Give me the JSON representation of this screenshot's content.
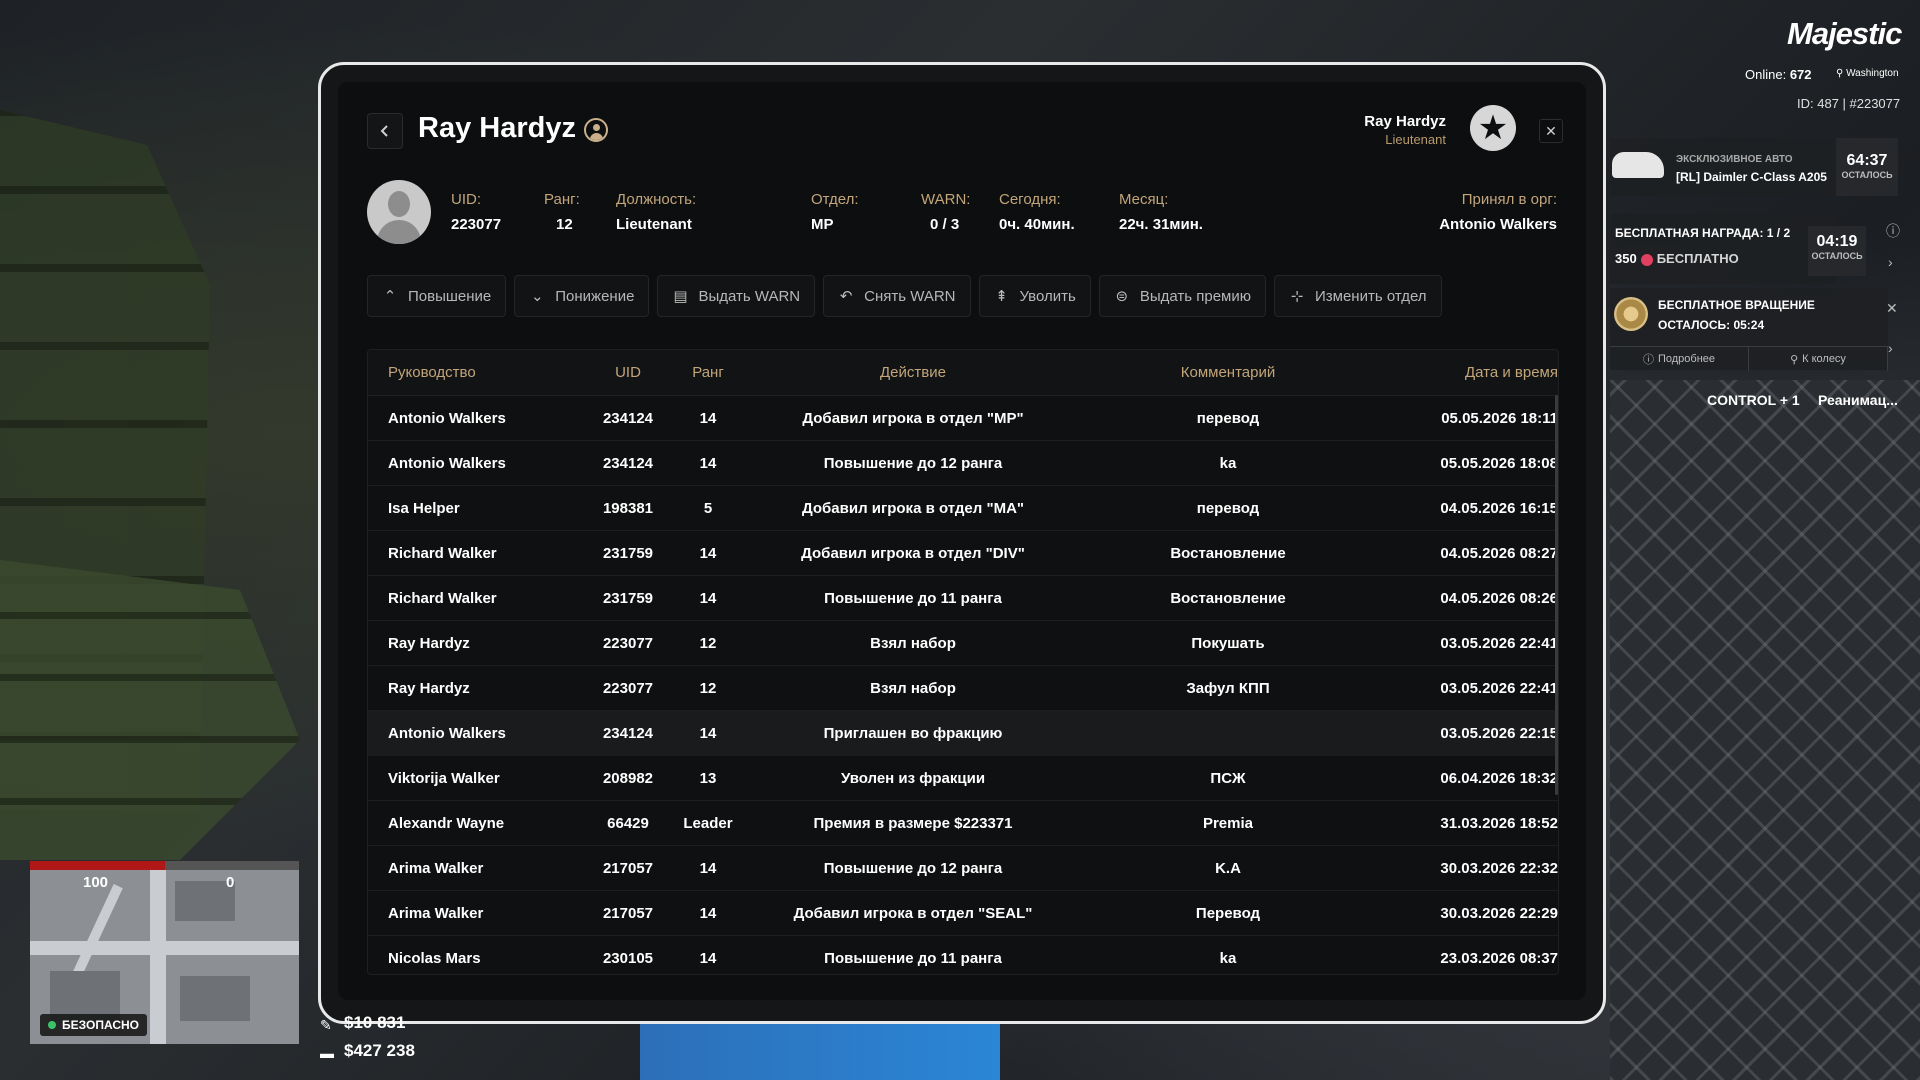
{
  "hud": {
    "logo": "Majestic",
    "online_label": "Online:",
    "online_count": "672",
    "city": "Washington",
    "id_line": "ID: 487 | #223077",
    "car": {
      "subtitle": "ЭКСКЛЮЗИВНОЕ АВТО",
      "name": "[RL] Daimler C-Class A205",
      "timer": "64:37",
      "timer_label": "ОСТАЛОСЬ"
    },
    "reward": {
      "title": "БЕСПЛАТНАЯ НАГРАДА: 1 / 2",
      "amount": "350",
      "free_label": "БЕСПЛАТНО",
      "timer": "04:19",
      "timer_label": "ОСТАЛОСЬ"
    },
    "spin": {
      "title": "БЕСПЛАТНОЕ ВРАЩЕНИЕ",
      "remaining": "ОСТАЛОСЬ: 05:24",
      "details_link": "Подробнее",
      "wheel_link": "К колесу"
    },
    "control_hint": "CONTROL + 1",
    "reanim_hint": "Реанимац...",
    "hp_left": "100",
    "hp_right": "0",
    "safe_label": "БЕЗОПАСНО",
    "cash": "$10 831",
    "bank": "$427 238",
    "hp_fraction": 0.5
  },
  "modal": {
    "title": "Ray Hardyz",
    "header_name": "Ray Hardyz",
    "header_rank": "Lieutenant",
    "info": {
      "uid_label": "UID:",
      "uid": "223077",
      "rank_label": "Ранг:",
      "rank": "12",
      "position_label": "Должность:",
      "position": "Lieutenant",
      "dept_label": "Отдел:",
      "dept": "MP",
      "warn_label": "WARN:",
      "warn": "0 / 3",
      "today_label": "Сегодня:",
      "today": "0ч. 40мин.",
      "month_label": "Месяц:",
      "month": "22ч. 31мин.",
      "accepted_label": "Принял в орг:",
      "accepted_by": "Antonio Walkers"
    },
    "buttons": {
      "promote": "Повышение",
      "demote": "Понижение",
      "give_warn": "Выдать WARN",
      "remove_warn": "Снять WARN",
      "fire": "Уволить",
      "give_bonus": "Выдать премию",
      "change_dept": "Изменить отдел"
    },
    "table": {
      "headers": [
        "Руководство",
        "UID",
        "Ранг",
        "Действие",
        "Комментарий",
        "Дата и время"
      ],
      "rows": [
        [
          "Antonio Walkers",
          "234124",
          "14",
          "Добавил игрока в отдел \"MP\"",
          "перевод",
          "05.05.2026 18:11"
        ],
        [
          "Antonio Walkers",
          "234124",
          "14",
          "Повышение до 12 ранга",
          "ka",
          "05.05.2026 18:08"
        ],
        [
          "Isa Helper",
          "198381",
          "5",
          "Добавил игрока в отдел \"MA\"",
          "перевод",
          "04.05.2026 16:15"
        ],
        [
          "Richard Walker",
          "231759",
          "14",
          "Добавил игрока в отдел \"DIV\"",
          "Востановление",
          "04.05.2026 08:27"
        ],
        [
          "Richard Walker",
          "231759",
          "14",
          "Повышение до 11 ранга",
          "Востановление",
          "04.05.2026 08:26"
        ],
        [
          "Ray Hardyz",
          "223077",
          "12",
          "Взял набор",
          "Покушать",
          "03.05.2026 22:41"
        ],
        [
          "Ray Hardyz",
          "223077",
          "12",
          "Взял набор",
          "Зафул КПП",
          "03.05.2026 22:41"
        ],
        [
          "Antonio Walkers",
          "234124",
          "14",
          "Приглашен во фракцию",
          "",
          "03.05.2026 22:15"
        ],
        [
          "Viktorija Walker",
          "208982",
          "13",
          "Уволен из фракции",
          "ПСЖ",
          "06.04.2026 18:32"
        ],
        [
          "Alexandr Wayne",
          "66429",
          "Leader",
          "Премия в размере $223371",
          "Premia",
          "31.03.2026 18:52"
        ],
        [
          "Arima Walker",
          "217057",
          "14",
          "Повышение до 12 ранга",
          "K.A",
          "30.03.2026 22:32"
        ],
        [
          "Arima Walker",
          "217057",
          "14",
          "Добавил игрока в отдел \"SEAL\"",
          "Перевод",
          "30.03.2026 22:29"
        ],
        [
          "Nicolas Mars",
          "230105",
          "14",
          "Повышение до 11 ранга",
          "ka",
          "23.03.2026 08:37"
        ]
      ],
      "highlighted_row": 7
    }
  }
}
